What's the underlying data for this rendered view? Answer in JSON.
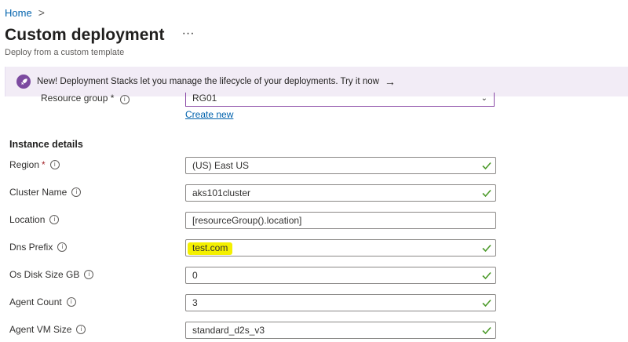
{
  "breadcrumb": {
    "home": "Home",
    "separator": ">"
  },
  "header": {
    "title": "Custom deployment",
    "more": "···",
    "subtitle": "Deploy from a custom template"
  },
  "banner": {
    "text": "New! Deployment Stacks let you manage the lifecycle of your deployments. Try it now",
    "arrow": "→"
  },
  "resource_group": {
    "label": "Resource group *",
    "value": "RG01",
    "create_new": "Create new"
  },
  "section": {
    "title": "Instance details"
  },
  "fields": [
    {
      "label": "Region",
      "required": true,
      "value": "(US) East US",
      "valid": true
    },
    {
      "label": "Cluster Name",
      "required": false,
      "value": "aks101cluster",
      "valid": true
    },
    {
      "label": "Location",
      "required": false,
      "value": "[resourceGroup().location]",
      "valid": false
    },
    {
      "label": "Dns Prefix",
      "required": false,
      "value": "test.com",
      "valid": true,
      "highlighted": true
    },
    {
      "label": "Os Disk Size GB",
      "required": false,
      "value": "0",
      "valid": true
    },
    {
      "label": "Agent Count",
      "required": false,
      "value": "3",
      "valid": true
    },
    {
      "label": "Agent VM Size",
      "required": false,
      "value": "standard_d2s_v3",
      "valid": true
    }
  ],
  "colors": {
    "link": "#0062ad",
    "valid_check": "#4c9a2a",
    "banner_bg": "#f2ecf6",
    "highlight": "#f4f000",
    "required": "#a4262c"
  }
}
